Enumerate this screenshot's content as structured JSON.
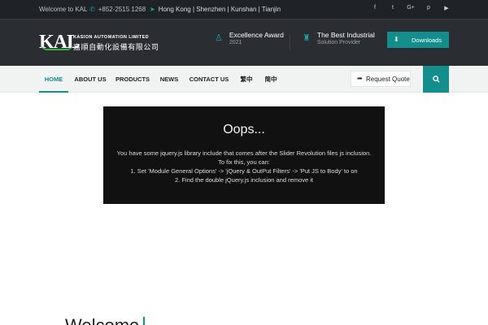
{
  "topbar": {
    "welcome": "Welcome to KAL",
    "phone": "+852-2515 1268",
    "locations": "Hong Kong | Shenzhen | Kunshan | Tianjin",
    "social_icons": [
      "facebook-icon",
      "twitter-icon",
      "google-plus-icon",
      "pinterest-icon",
      "youtube-icon"
    ],
    "social_glyphs": [
      "f",
      "t",
      "G+",
      "p",
      "▶"
    ]
  },
  "header": {
    "logo_mark": "KAL",
    "company_name": "KASION AUTOMATION LIMITED",
    "company_name_cn": "嘉順自動化設備有限公司",
    "award": {
      "title": "Excellence Award",
      "subtitle": "2021"
    },
    "industrial": {
      "title": "The Best Industrial",
      "subtitle": "Solution Provider"
    },
    "downloads_label": "Downloads"
  },
  "nav": {
    "items": [
      "HOME",
      "ABOUT US",
      "PRODUCTS",
      "NEWS",
      "CONTACT US",
      "繁中",
      "简中"
    ],
    "active": "HOME",
    "quote_label": "Request Quote"
  },
  "error": {
    "title": "Oops...",
    "lines": [
      "You have some jquery.js library include that comes after the Slider Revolution files js inclusion.",
      "To fix this, you can:",
      "1. Set 'Module General Options' -> 'jQuery & OutPut Filters' -> 'Put JS to Body' to on",
      "2. Find the double jQuery.js inclusion and remove it"
    ]
  },
  "section": {
    "heading_partial": "Welcome"
  },
  "colors": {
    "accent": "#138e8c",
    "topbar": "#1f2327",
    "header": "#2a2e33",
    "kal_green": "#3bb54a"
  }
}
